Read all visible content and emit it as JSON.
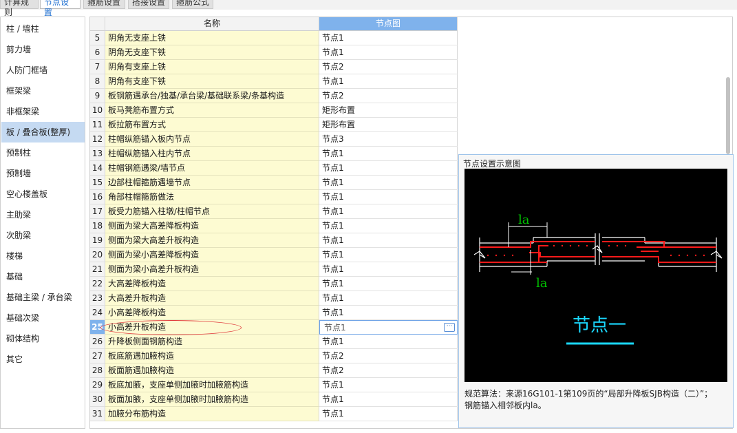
{
  "tabs": [
    {
      "label": "计算规则",
      "active": false
    },
    {
      "label": "节点设置",
      "active": true
    },
    {
      "label": "箍筋设置",
      "active": false
    },
    {
      "label": "搭接设置",
      "active": false
    },
    {
      "label": "箍筋公式",
      "active": false
    }
  ],
  "sidebar": {
    "items": [
      {
        "label": "柱 / 墙柱"
      },
      {
        "label": "剪力墙"
      },
      {
        "label": "人防门框墙"
      },
      {
        "label": "框架梁"
      },
      {
        "label": "非框架梁"
      },
      {
        "label": "板 / 叠合板(整厚)",
        "active": true
      },
      {
        "label": "预制柱"
      },
      {
        "label": "预制墙"
      },
      {
        "label": "空心楼盖板"
      },
      {
        "label": "主肋梁"
      },
      {
        "label": "次肋梁"
      },
      {
        "label": "楼梯"
      },
      {
        "label": "基础"
      },
      {
        "label": "基础主梁 / 承台梁"
      },
      {
        "label": "基础次梁"
      },
      {
        "label": "砌体结构"
      },
      {
        "label": "其它"
      }
    ]
  },
  "table": {
    "headers": {
      "name": "名称",
      "value": "节点图"
    },
    "rows": [
      {
        "num": "5",
        "name": "阴角无支座上铁",
        "value": "节点1"
      },
      {
        "num": "6",
        "name": "阴角无支座下铁",
        "value": "节点1"
      },
      {
        "num": "7",
        "name": "阴角有支座上铁",
        "value": "节点2"
      },
      {
        "num": "8",
        "name": "阴角有支座下铁",
        "value": "节点1"
      },
      {
        "num": "9",
        "name": "板钢筋遇承台/独基/承台梁/基础联系梁/条基构造",
        "value": "节点2"
      },
      {
        "num": "10",
        "name": "板马凳筋布置方式",
        "value": "矩形布置"
      },
      {
        "num": "11",
        "name": "板拉筋布置方式",
        "value": "矩形布置"
      },
      {
        "num": "12",
        "name": "柱帽纵筋锚入板内节点",
        "value": "节点3"
      },
      {
        "num": "13",
        "name": "柱帽纵筋锚入柱内节点",
        "value": "节点1"
      },
      {
        "num": "14",
        "name": "柱帽钢筋遇梁/墙节点",
        "value": "节点1"
      },
      {
        "num": "15",
        "name": "边部柱帽箍筋遇墙节点",
        "value": "节点1"
      },
      {
        "num": "16",
        "name": "角部柱帽箍筋做法",
        "value": "节点1"
      },
      {
        "num": "17",
        "name": "板受力筋锚入柱墩/柱帽节点",
        "value": "节点1"
      },
      {
        "num": "18",
        "name": "侧面为梁大高差降板构造",
        "value": "节点1"
      },
      {
        "num": "19",
        "name": "侧面为梁大高差升板构造",
        "value": "节点1"
      },
      {
        "num": "20",
        "name": "侧面为梁小高差降板构造",
        "value": "节点1"
      },
      {
        "num": "21",
        "name": "侧面为梁小高差升板构造",
        "value": "节点1"
      },
      {
        "num": "22",
        "name": "大高差降板构造",
        "value": "节点1"
      },
      {
        "num": "23",
        "name": "大高差升板构造",
        "value": "节点1"
      },
      {
        "num": "24",
        "name": "小高差降板构造",
        "value": "节点1"
      },
      {
        "num": "25",
        "name": "小高差升板构造",
        "value": "节点1",
        "selected": true
      },
      {
        "num": "26",
        "name": "升降板侧面钢筋构造",
        "value": "节点1"
      },
      {
        "num": "27",
        "name": "板底筋遇加腋构造",
        "value": "节点2"
      },
      {
        "num": "28",
        "name": "板面筋遇加腋构造",
        "value": "节点2"
      },
      {
        "num": "29",
        "name": "板底加腋，支座单侧加腋时加腋筋构造",
        "value": "节点1"
      },
      {
        "num": "30",
        "name": "板面加腋，支座单侧加腋时加腋筋构造",
        "value": "节点1"
      },
      {
        "num": "31",
        "name": "加腋分布筋构造",
        "value": "节点1"
      }
    ],
    "ellipsis_label": "···"
  },
  "preview": {
    "title": "节点设置示意图",
    "diagram": {
      "label_top": "la",
      "label_bottom": "la",
      "caption": "节点一",
      "colors": {
        "background": "#000000",
        "outline": "#ffffff",
        "rebar": "#ff1a1a",
        "dimension": "#00c000",
        "caption": "#1ad8ff"
      }
    },
    "description_line1": "规范算法：来源16G101-1第109页的“局部升降板SJB构造（二）”；",
    "description_line2": "钢筋锚入相邻板内la。"
  },
  "colors": {
    "selected_blue": "#7fb2ec",
    "sidebar_active": "#c5daf2",
    "name_cell_bg": "#fdfbd2",
    "annotation_red": "#e03b3b"
  }
}
